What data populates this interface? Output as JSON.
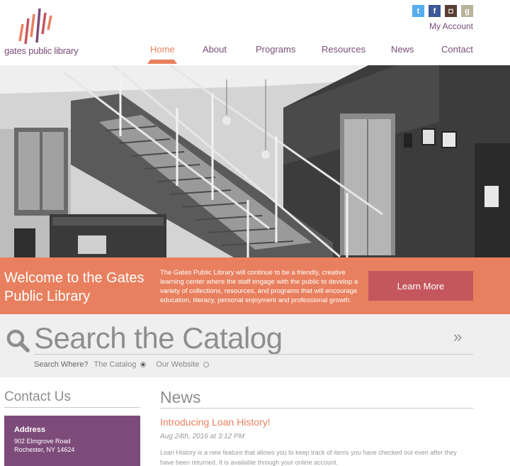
{
  "logo": {
    "text": "gates public library"
  },
  "social": {
    "twitter": "t",
    "facebook": "f",
    "instagram": "◘",
    "goodreads": "g"
  },
  "header": {
    "account": "My Account"
  },
  "nav": [
    "Home",
    "About",
    "Programs",
    "Resources",
    "News",
    "Contact"
  ],
  "welcome": {
    "title": "Welcome to the Gates Public Library",
    "text": "The Gates Public Library will continue to be a friendly, creative learning center where the staff engage with the public to develop a variety of collections, resources, and programs that will encourage education, literacy, personal enjoyment and professional growth.",
    "button": "Learn More"
  },
  "search": {
    "title": "Search the Catalog",
    "go": "»",
    "where_label": "Search Where?",
    "options": [
      "The Catalog",
      "Our Website"
    ],
    "selected": "The Catalog"
  },
  "contact": {
    "title": "Contact Us",
    "address_label": "Address",
    "address_lines": [
      "902 Elmgrove Road",
      "Rochester, NY 14624"
    ]
  },
  "news": {
    "title": "News",
    "items": [
      {
        "heading": "Introducing Loan History!",
        "date": "Aug 24th, 2016 at 3:12 PM",
        "body": "Loan History is a new feature that allows you to keep track of items you have checked out even after they have been returned. It is available through your online account."
      }
    ]
  },
  "colors": {
    "accent": "#e8805f",
    "brand": "#7d4b7a",
    "button": "#c4575d",
    "search_bg": "#efefef"
  }
}
